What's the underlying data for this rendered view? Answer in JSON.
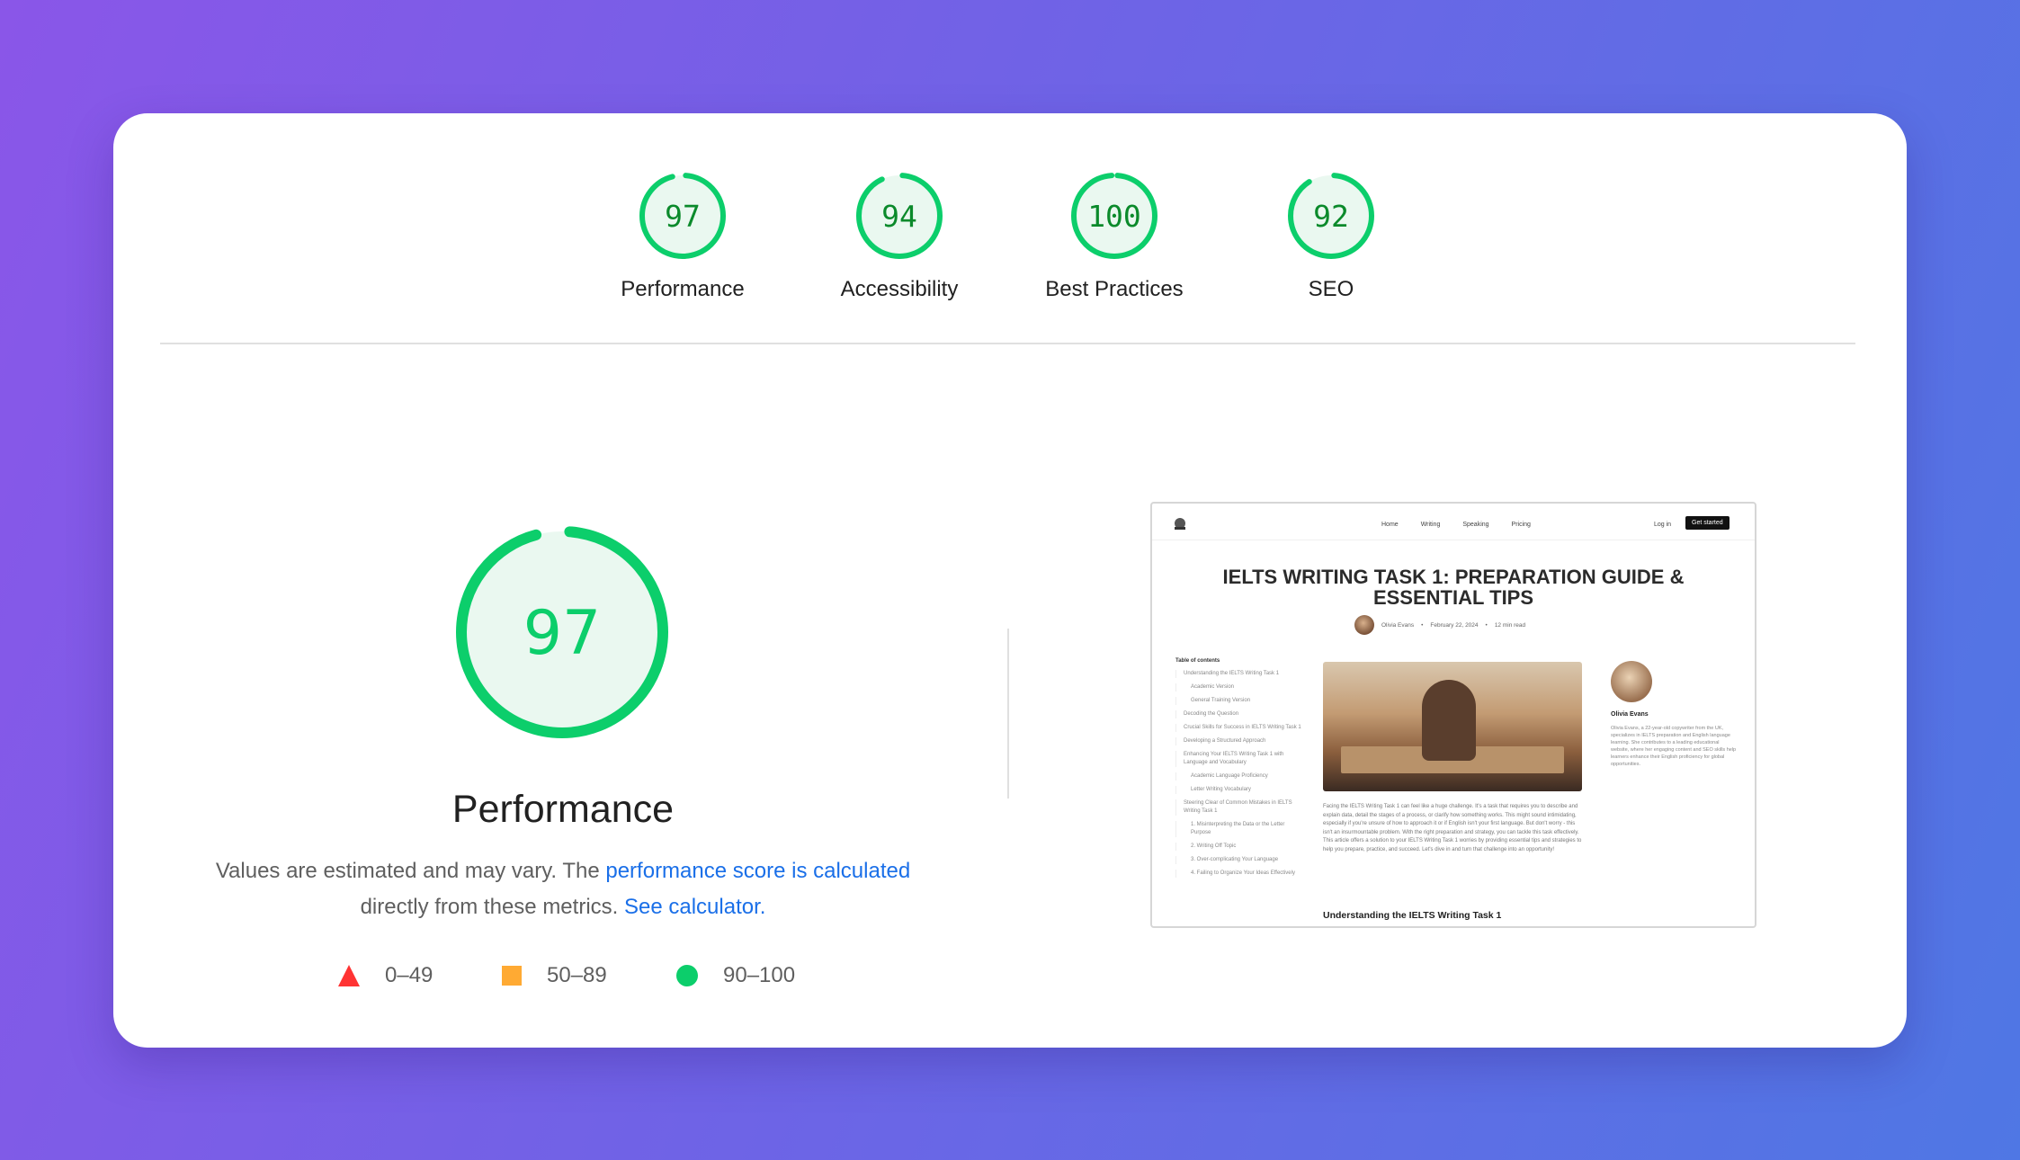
{
  "colors": {
    "pass": "#0cce6b",
    "pass_text": "#0b8a2b",
    "average": "#ffaa33",
    "fail": "#ff3333",
    "link": "#1a6fe8"
  },
  "summary_gauges": [
    {
      "label": "Performance",
      "score": 97
    },
    {
      "label": "Accessibility",
      "score": 94
    },
    {
      "label": "Best Practices",
      "score": 100
    },
    {
      "label": "SEO",
      "score": 92
    }
  ],
  "main": {
    "score": 97,
    "title": "Performance",
    "description_prefix": "Values are estimated and may vary. The ",
    "description_link1": "performance score is calculated",
    "description_middle": " directly from these metrics. ",
    "description_link2": "See calculator."
  },
  "legend": [
    {
      "icon": "triangle-icon",
      "range": "0–49"
    },
    {
      "icon": "square-icon",
      "range": "50–89"
    },
    {
      "icon": "circle-icon",
      "range": "90–100"
    }
  ],
  "screenshot": {
    "nav_links": [
      "Home",
      "Writing",
      "Speaking",
      "Pricing"
    ],
    "login": "Log in",
    "cta": "Get started",
    "title": "IELTS WRITING TASK 1: PREPARATION GUIDE & ESSENTIAL TIPS",
    "author": "Olivia Evans",
    "date": "February 22, 2024",
    "read_time": "12 min read",
    "toc_heading": "Table of contents",
    "toc": [
      {
        "text": "Understanding the IELTS Writing Task 1",
        "sub": false
      },
      {
        "text": "Academic Version",
        "sub": true
      },
      {
        "text": "General Training Version",
        "sub": true
      },
      {
        "text": "Decoding the Question",
        "sub": false
      },
      {
        "text": "Crucial Skills for Success in IELTS Writing Task 1",
        "sub": false
      },
      {
        "text": "Developing a Structured Approach",
        "sub": false
      },
      {
        "text": "Enhancing Your IELTS Writing Task 1 with Language and Vocabulary",
        "sub": false
      },
      {
        "text": "Academic Language Proficiency",
        "sub": true
      },
      {
        "text": "Letter Writing Vocabulary",
        "sub": true
      },
      {
        "text": "Steering Clear of Common Mistakes in IELTS Writing Task 1",
        "sub": false
      },
      {
        "text": "1. Misinterpreting the Data or the Letter Purpose",
        "sub": true
      },
      {
        "text": "2. Writing Off Topic",
        "sub": true
      },
      {
        "text": "3. Over-complicating Your Language",
        "sub": true
      },
      {
        "text": "4. Failing to Organize Your Ideas Effectively",
        "sub": true
      }
    ],
    "intro": "Facing the IELTS Writing Task 1 can feel like a huge challenge. It's a task that requires you to describe and explain data, detail the stages of a process, or clarify how something works. This might sound intimidating, especially if you're unsure of how to approach it or if English isn't your first language. But don't worry - this isn't an insurmountable problem. With the right preparation and strategy, you can tackle this task effectively. This article offers a solution to your IELTS Writing Task 1 worries by providing essential tips and strategies to help you prepare, practice, and succeed. Let's dive in and turn that challenge into an opportunity!",
    "section_heading": "Understanding the IELTS Writing Task 1",
    "author_bio": "Olivia Evans, a 22-year-old copywriter from the UK, specializes in IELTS preparation and English language learning. She contributes to a leading educational website, where her engaging content and SEO skills help learners enhance their English proficiency for global opportunities."
  }
}
